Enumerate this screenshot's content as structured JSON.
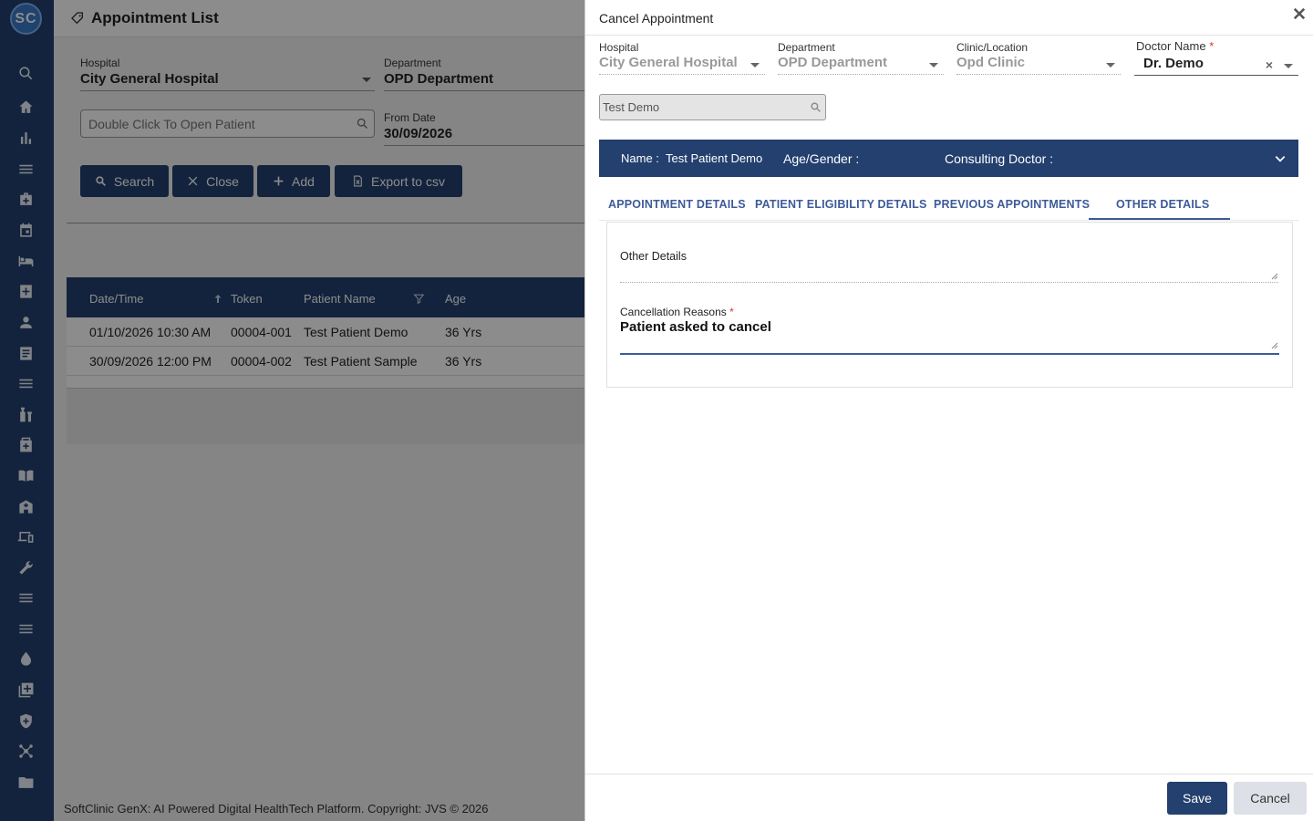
{
  "app": {
    "logo_text": "SC",
    "page_title": "Appointment List",
    "footer": "SoftClinic GenX: AI Powered Digital HealthTech Platform. Copyright: JVS © 2026"
  },
  "sidebar": {
    "icons": [
      "search-icon",
      "home-icon",
      "chart-icon",
      "menu-icon",
      "medical-bag-icon",
      "calendar-icon",
      "bed-icon",
      "plus-box-icon",
      "person-icon",
      "document-icon",
      "list-icon",
      "medicine-icon",
      "first-aid-icon",
      "book-icon",
      "building-icon",
      "devices-icon",
      "wrench-icon",
      "menu-icon",
      "menu-icon",
      "drop-icon",
      "add-library-icon",
      "shield-icon",
      "network-icon",
      "folder-icon"
    ]
  },
  "filters": {
    "hospital_label": "Hospital",
    "hospital_value": "City General Hospital",
    "department_label": "Department",
    "department_value": "OPD Department",
    "patient_placeholder": "Double Click To Open Patient",
    "from_date_label": "From Date",
    "from_date_value": "30/09/2026"
  },
  "actions": {
    "search": "Search",
    "close": "Close",
    "add": "Add",
    "export": "Export to csv"
  },
  "table": {
    "headers": [
      "Date/Time",
      "Token",
      "Patient Name",
      "Age"
    ],
    "rows": [
      {
        "datetime": "01/10/2026 10:30 AM",
        "token": "00004-001",
        "name": "Test Patient Demo",
        "age": "36 Yrs"
      },
      {
        "datetime": "30/09/2026 12:00 PM",
        "token": "00004-002",
        "name": "Test Patient Sample",
        "age": "36 Yrs"
      }
    ]
  },
  "dialog": {
    "title": "Cancel Appointment",
    "hospital_label": "Hospital",
    "hospital_value": "City General Hospital",
    "department_label": "Department",
    "department_value": "OPD Department",
    "clinic_label": "Clinic/Location",
    "clinic_value": "Opd Clinic",
    "doctor_label": "Doctor Name",
    "doctor_required": "*",
    "doctor_value": "Dr. Demo",
    "doctor_clear": "×",
    "search_value": "Test Demo",
    "patient_bar": {
      "name_label": "Name :",
      "name_value": "Test Patient Demo",
      "age_gender_label": "Age/Gender :",
      "consulting_label": "Consulting Doctor :"
    },
    "tabs": [
      "APPOINTMENT DETAILS",
      "PATIENT ELIGIBILITY DETAILS",
      "PREVIOUS APPOINTMENTS",
      "OTHER DETAILS"
    ],
    "active_tab": "OTHER DETAILS",
    "other_details_label": "Other Details",
    "other_details_value": "",
    "cancellation_label": "Cancellation Reasons",
    "cancellation_required": "*",
    "cancellation_value": "Patient asked to cancel",
    "save": "Save",
    "cancel": "Cancel"
  },
  "colors": {
    "primary": "#23406f",
    "tab_accent": "#3d5a99",
    "required": "#d33333"
  }
}
